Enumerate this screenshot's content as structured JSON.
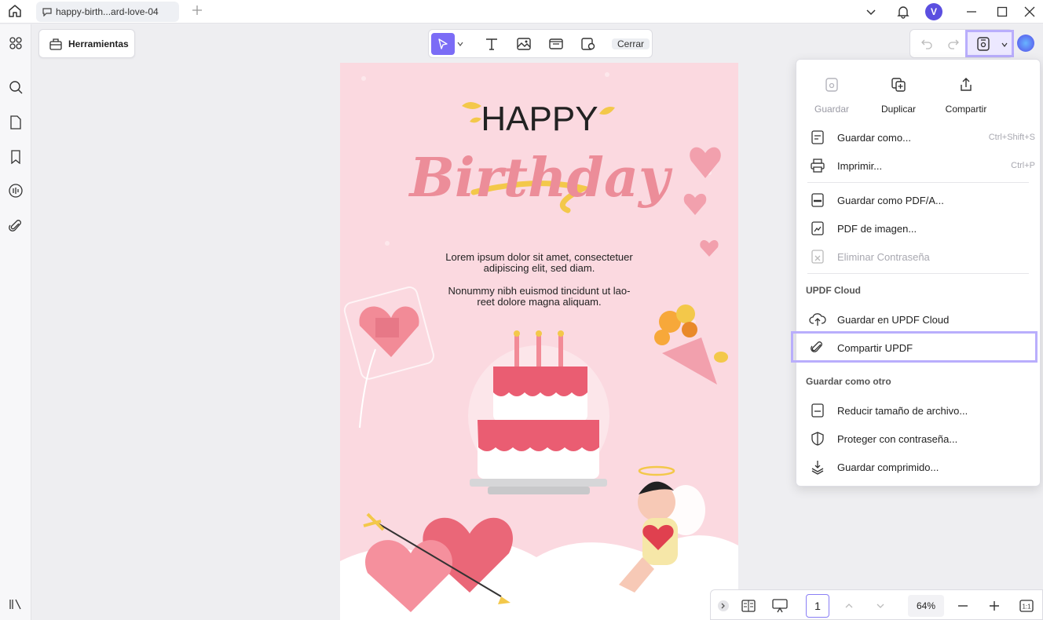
{
  "titlebar": {
    "tab_title": "happy-birth...ard-love-04",
    "avatar_initial": "V"
  },
  "toolbar": {
    "tools_label": "Herramientas",
    "close_label": "Cerrar"
  },
  "document": {
    "heading_happy": "HAPPY",
    "heading_birthday": "Birthday",
    "paragraph1_line1": "Lorem ipsum dolor sit amet, consectetuer",
    "paragraph1_line2": "adipiscing elit, sed diam.",
    "paragraph2_line1": "Nonummy nibh euismod tincidunt ut lao-",
    "paragraph2_line2": "reet dolore magna aliquam."
  },
  "menu": {
    "top_actions": [
      {
        "label": "Guardar",
        "icon": "save-icon",
        "disabled": true
      },
      {
        "label": "Duplicar",
        "icon": "duplicate-icon",
        "disabled": false
      },
      {
        "label": "Compartir",
        "icon": "share-icon",
        "disabled": false
      }
    ],
    "items": {
      "save_as": {
        "label": "Guardar como...",
        "shortcut": "Ctrl+Shift+S"
      },
      "print": {
        "label": "Imprimir...",
        "shortcut": "Ctrl+P"
      },
      "save_pdfa": {
        "label": "Guardar como PDF/A..."
      },
      "image_pdf": {
        "label": "PDF de imagen..."
      },
      "remove_password": {
        "label": "Eliminar Contraseña",
        "disabled": true
      },
      "save_cloud": {
        "label": "Guardar en UPDF Cloud"
      },
      "share_updf": {
        "label": "Compartir UPDF"
      },
      "reduce_size": {
        "label": "Reducir tamaño de archivo..."
      },
      "protect": {
        "label": "Proteger con contraseña..."
      },
      "save_compressed": {
        "label": "Guardar comprimido..."
      }
    },
    "section_cloud": "UPDF Cloud",
    "section_other": "Guardar como otro"
  },
  "bottombar": {
    "page_number": "1",
    "zoom": "64%"
  },
  "colors": {
    "accent": "#7b6cf6",
    "highlight": "#b9aefc",
    "doc_bg": "#fbd9e0"
  }
}
